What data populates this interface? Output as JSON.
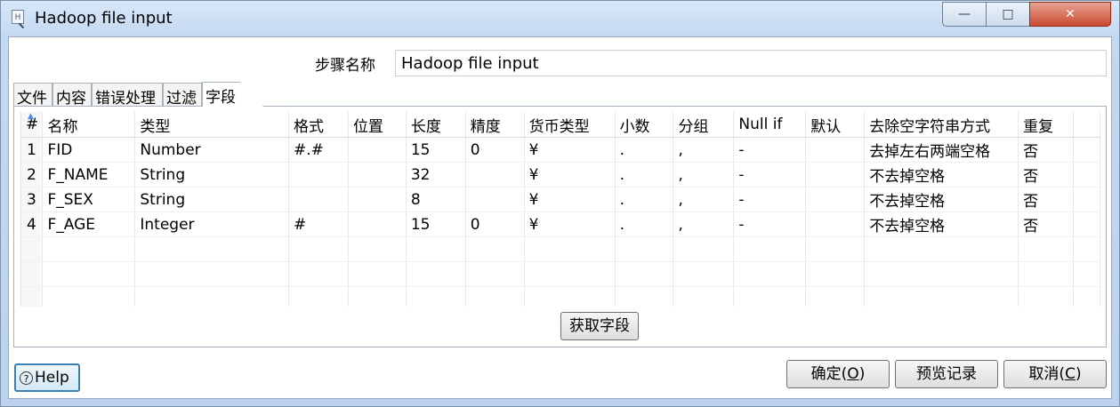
{
  "window": {
    "title": "Hadoop file input",
    "min_glyph": "—",
    "max_glyph": "□",
    "close_glyph": "✕"
  },
  "step": {
    "label": "步骤名称",
    "value": "Hadoop file input"
  },
  "tabs": [
    {
      "label": "文件"
    },
    {
      "label": "内容"
    },
    {
      "label": "错误处理"
    },
    {
      "label": "过滤"
    },
    {
      "label": "字段"
    }
  ],
  "fields_table": {
    "columns": [
      "#",
      "名称",
      "类型",
      "格式",
      "位置",
      "长度",
      "精度",
      "货币类型",
      "小数",
      "分组",
      "Null if",
      "默认",
      "去除空字符串方式",
      "重复"
    ],
    "rows": [
      [
        "1",
        "FID",
        "Number",
        "#.#",
        "",
        "15",
        "0",
        "¥",
        ".",
        ",",
        "-",
        "",
        "去掉左右两端空格",
        "否"
      ],
      [
        "2",
        "F_NAME",
        "String",
        "",
        "",
        "32",
        "",
        "¥",
        ".",
        ",",
        "-",
        "",
        "不去掉空格",
        "否"
      ],
      [
        "3",
        "F_SEX",
        "String",
        "",
        "",
        "8",
        "",
        "¥",
        ".",
        ",",
        "-",
        "",
        "不去掉空格",
        "否"
      ],
      [
        "4",
        "F_AGE",
        "Integer",
        "#",
        "",
        "15",
        "0",
        "¥",
        ".",
        ",",
        "-",
        "",
        "不去掉空格",
        "否"
      ]
    ]
  },
  "buttons": {
    "get_fields": "获取字段",
    "help": "Help",
    "ok_prefix": "确定(",
    "ok_key": "O",
    "ok_suffix": ")",
    "preview": "预览记录",
    "cancel_prefix": "取消(",
    "cancel_key": "C",
    "cancel_suffix": ")"
  }
}
